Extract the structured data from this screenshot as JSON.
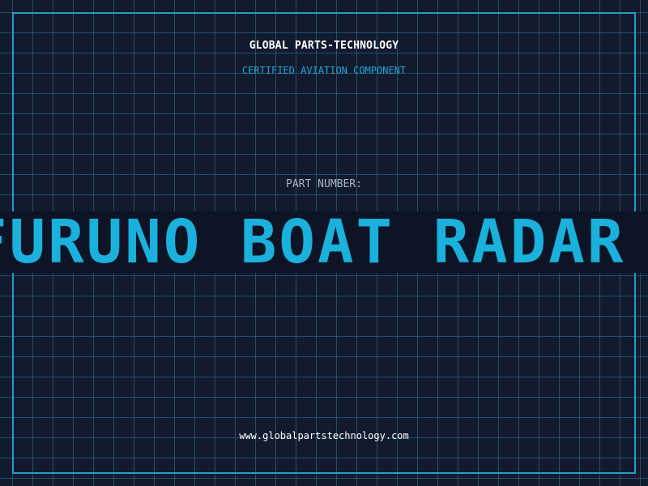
{
  "header": {
    "company": "GLOBAL PARTS-TECHNOLOGY",
    "subtitle": "CERTIFIED AVIATION COMPONENT"
  },
  "part": {
    "label": "PART NUMBER:",
    "value": "FURUNO BOAT RADAR SYSTEM"
  },
  "footer": {
    "url": "www.globalpartstechnology.com"
  },
  "colors": {
    "background": "#121a2e",
    "grid": "#2e7c96",
    "accent": "#1ab1dc",
    "banner_bg": "#0d1426"
  }
}
